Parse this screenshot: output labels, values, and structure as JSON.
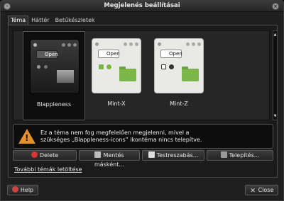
{
  "window": {
    "title": "Megjelenés beállításai"
  },
  "tabs": [
    {
      "label": "Téma"
    },
    {
      "label": "Háttér"
    },
    {
      "label": "Betűkészletek"
    }
  ],
  "themes": [
    {
      "name": "Blappleness",
      "open_label": "Open"
    },
    {
      "name": "Mint-X",
      "open_label": "Open"
    },
    {
      "name": "Mint-Z",
      "open_label": "Open"
    }
  ],
  "info": {
    "line1": "Ez a téma nem fog megfelelően megjelenni, mivel a",
    "line2": "szükséges „Blappleness-icons” ikontéma nincs telepítve."
  },
  "actions": {
    "delete": "Delete",
    "save_copy": "Mentés másként...",
    "customize": "Testreszabás...",
    "install": "Telepítés..."
  },
  "link": {
    "more_themes": "További témák letöltése"
  },
  "footer": {
    "help": "Help",
    "close": "Close"
  },
  "colors": {
    "accent_folder": "#7ab648",
    "warning": "#e8902c"
  }
}
